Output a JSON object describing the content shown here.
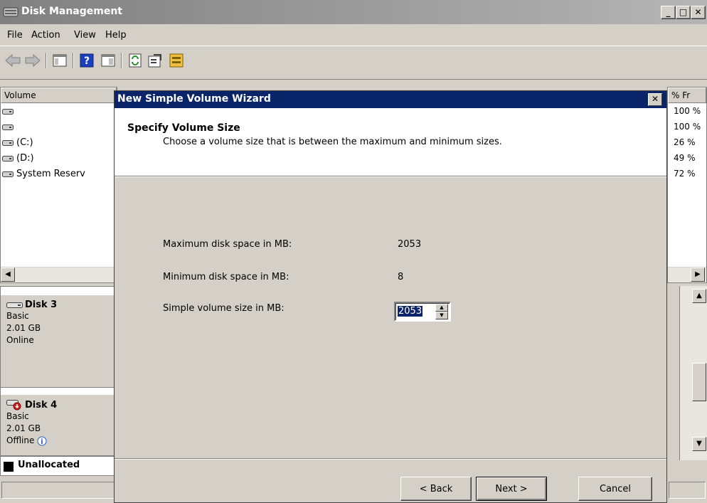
{
  "window": {
    "title": "Disk Management",
    "minimize": "_",
    "maximize": "□",
    "close": "✕"
  },
  "menu": [
    {
      "label": "File"
    },
    {
      "label": "Action"
    },
    {
      "label": "View"
    },
    {
      "label": "Help"
    }
  ],
  "volume_list": {
    "column_header": "Volume",
    "items": [
      {
        "label": ""
      },
      {
        "label": ""
      },
      {
        "label": "(C:)"
      },
      {
        "label": "(D:)"
      },
      {
        "label": "System Reserv"
      }
    ]
  },
  "percent_list": {
    "column_header": "% Fr",
    "items": [
      "100 %",
      "100 %",
      "26 %",
      "49 %",
      "72 %"
    ]
  },
  "disks": [
    {
      "name": "Disk 3",
      "type": "Basic",
      "size": "2.01 GB",
      "status": "Online"
    },
    {
      "name": "Disk 4",
      "type": "Basic",
      "size": "2.01 GB",
      "status": "Offline"
    }
  ],
  "legend": {
    "label": "Unallocated",
    "color": "#000000"
  },
  "wizard": {
    "title": "New Simple Volume Wizard",
    "close": "✕",
    "header_title": "Specify Volume Size",
    "header_subtitle": "Choose a volume size that is between the maximum and minimum sizes.",
    "max_label": "Maximum disk space in MB:",
    "max_value": "2053",
    "min_label": "Minimum disk space in MB:",
    "min_value": "8",
    "size_label": "Simple volume size in MB:",
    "size_value": "2053",
    "back_button": "< Back",
    "next_button": "Next >",
    "cancel_button": "Cancel"
  },
  "colors": {
    "dialog_title_bg": "#0a246a",
    "window_title_bg": "#808080",
    "face": "#d4d0c8"
  }
}
